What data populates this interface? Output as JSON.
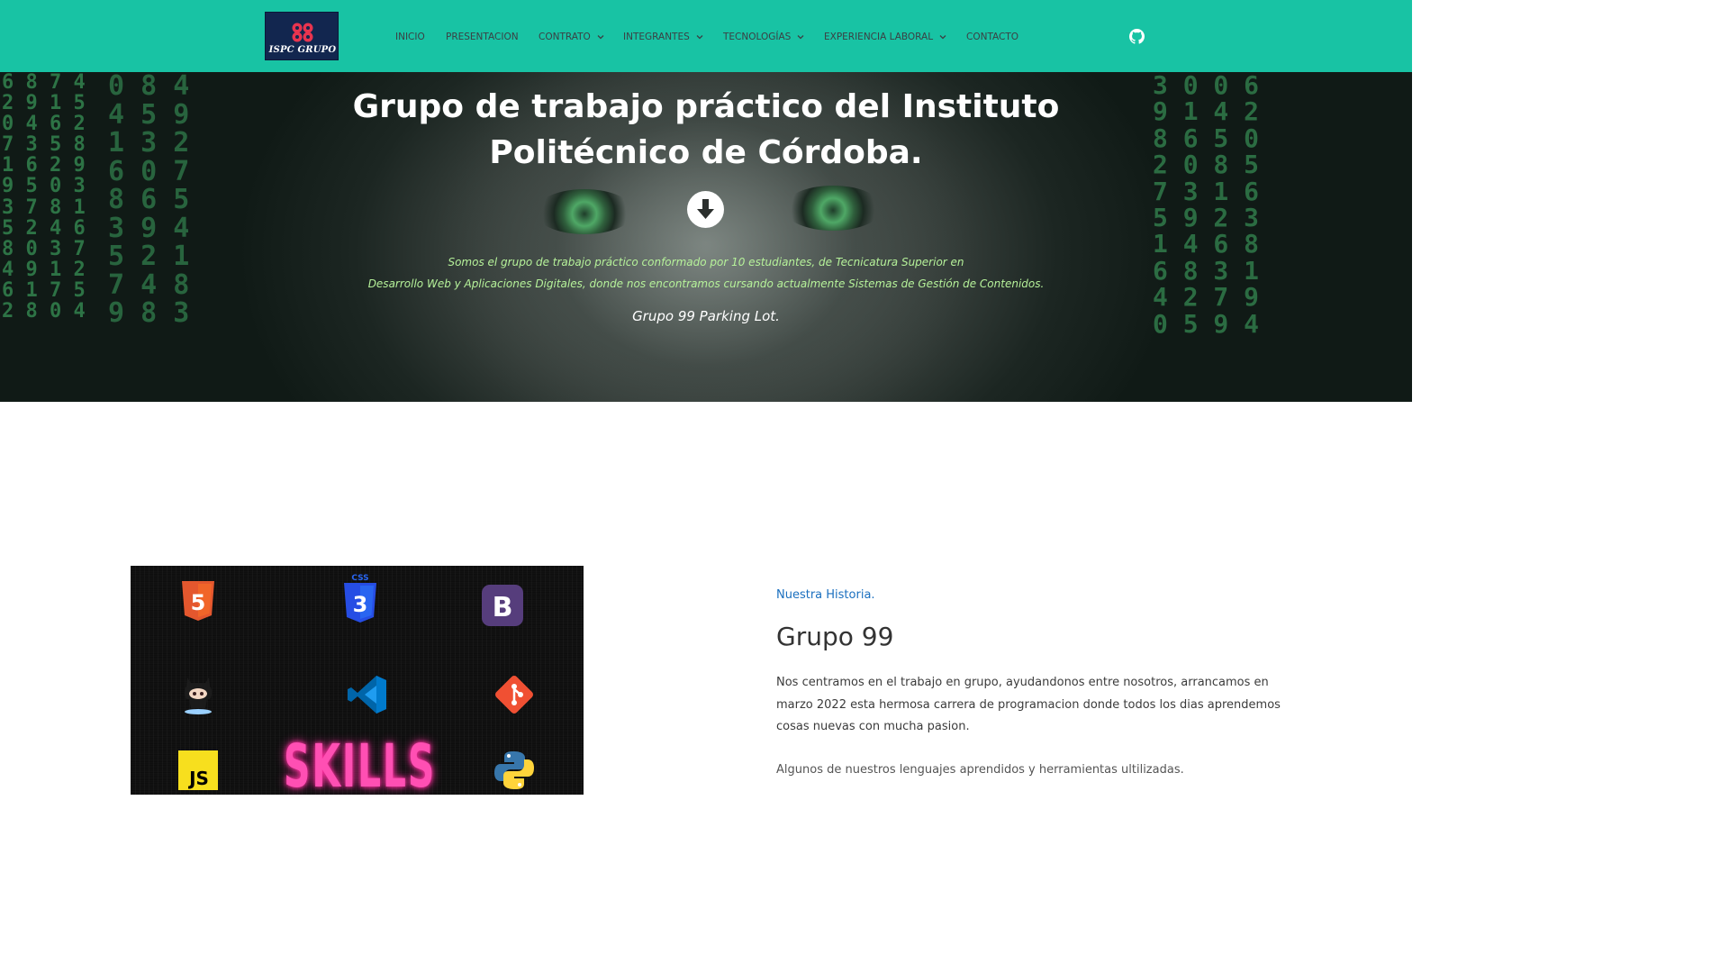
{
  "brand": {
    "logo_text": "ISPC GRUPO"
  },
  "nav": {
    "items": [
      {
        "label": "INICIO",
        "dropdown": false
      },
      {
        "label": "PRESENTACION",
        "dropdown": false
      },
      {
        "label": "CONTRATO",
        "dropdown": true
      },
      {
        "label": "INTEGRANTES",
        "dropdown": true
      },
      {
        "label": "TECNOLOGÍAS",
        "dropdown": true
      },
      {
        "label": "EXPERIENCIA LABORAL",
        "dropdown": true
      },
      {
        "label": "CONTACTO",
        "dropdown": false
      }
    ],
    "github_icon": "github-icon"
  },
  "hero": {
    "title_line1": "Grupo de trabajo práctico del Instituto",
    "title_line2": "Politécnico de Córdoba.",
    "desc_line1": "Somos el grupo de trabajo práctico conformado por 10 estudiantes, de Tecnicatura Superior en",
    "desc_line2": "Desarrollo Web y Aplicaciones Digitales, donde nos encontramos cursando actualmente Sistemas de Gestión de Contenidos.",
    "subtitle": "Grupo 99 Parking Lot.",
    "down_icon": "arrow-down-circle-icon"
  },
  "skills_image": {
    "caption": "SKILLS",
    "css_badge": "CSS",
    "js_badge": "JS",
    "bootstrap_letter": "B",
    "html_number": "5",
    "css_number": "3",
    "icons": [
      "html5-icon",
      "css3-icon",
      "bootstrap-icon",
      "github-octocat-icon",
      "vscode-icon",
      "git-icon",
      "javascript-icon",
      "python-icon"
    ]
  },
  "history": {
    "kicker": "Nuestra Historia.",
    "title": "Grupo 99",
    "paragraph1_line1": "Nos centramos en el trabajo en grupo, ayudandonos entre nosotros, arrancamos en",
    "paragraph1_line2": "marzo 2022 esta hermosa carrera de programacion donde todos los dias aprendemos",
    "paragraph1_line3": "cosas nuevas con mucha pasion.",
    "paragraph2": "Algunos de nuestros lenguajes aprendidos y herramientas ultilizadas."
  },
  "colors": {
    "navbar": "#18c3a4",
    "logo_bg": "#12264f",
    "kicker": "#1a6fbf",
    "hero_desc": "#b6f29a",
    "skills_text": "#ff4fb3"
  }
}
